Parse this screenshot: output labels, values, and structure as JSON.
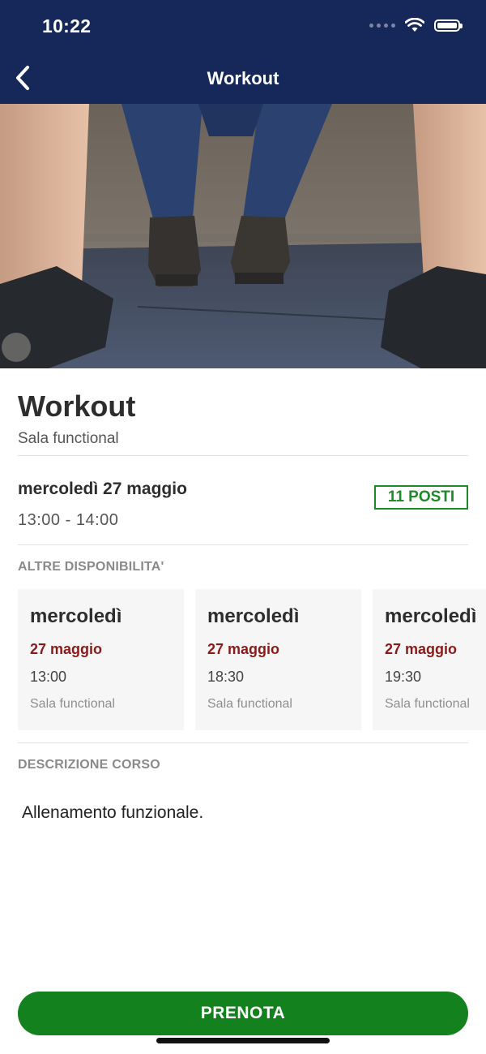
{
  "status_bar": {
    "time": "10:22"
  },
  "nav": {
    "title": "Workout",
    "back_icon": "chevron-left-icon"
  },
  "course": {
    "title": "Workout",
    "room": "Sala functional",
    "date": "mercoledì 27 maggio",
    "time": "13:00 - 14:00",
    "seats": "11 POSTI"
  },
  "other_slots": {
    "label": "ALTRE DISPONIBILITA'",
    "items": [
      {
        "day": "mercoledì",
        "date": "27 maggio",
        "time": "13:00",
        "room": "Sala functional"
      },
      {
        "day": "mercoledì",
        "date": "27 maggio",
        "time": "18:30",
        "room": "Sala functional"
      },
      {
        "day": "mercoledì",
        "date": "27 maggio",
        "time": "19:30",
        "room": "Sala functional"
      }
    ]
  },
  "description": {
    "label": "DESCRIZIONE CORSO",
    "text": "Allenamento funzionale."
  },
  "book_button": {
    "label": "PRENOTA"
  },
  "colors": {
    "header_bg": "#16285a",
    "accent_green": "#13821e",
    "date_red": "#8b1a1a"
  }
}
